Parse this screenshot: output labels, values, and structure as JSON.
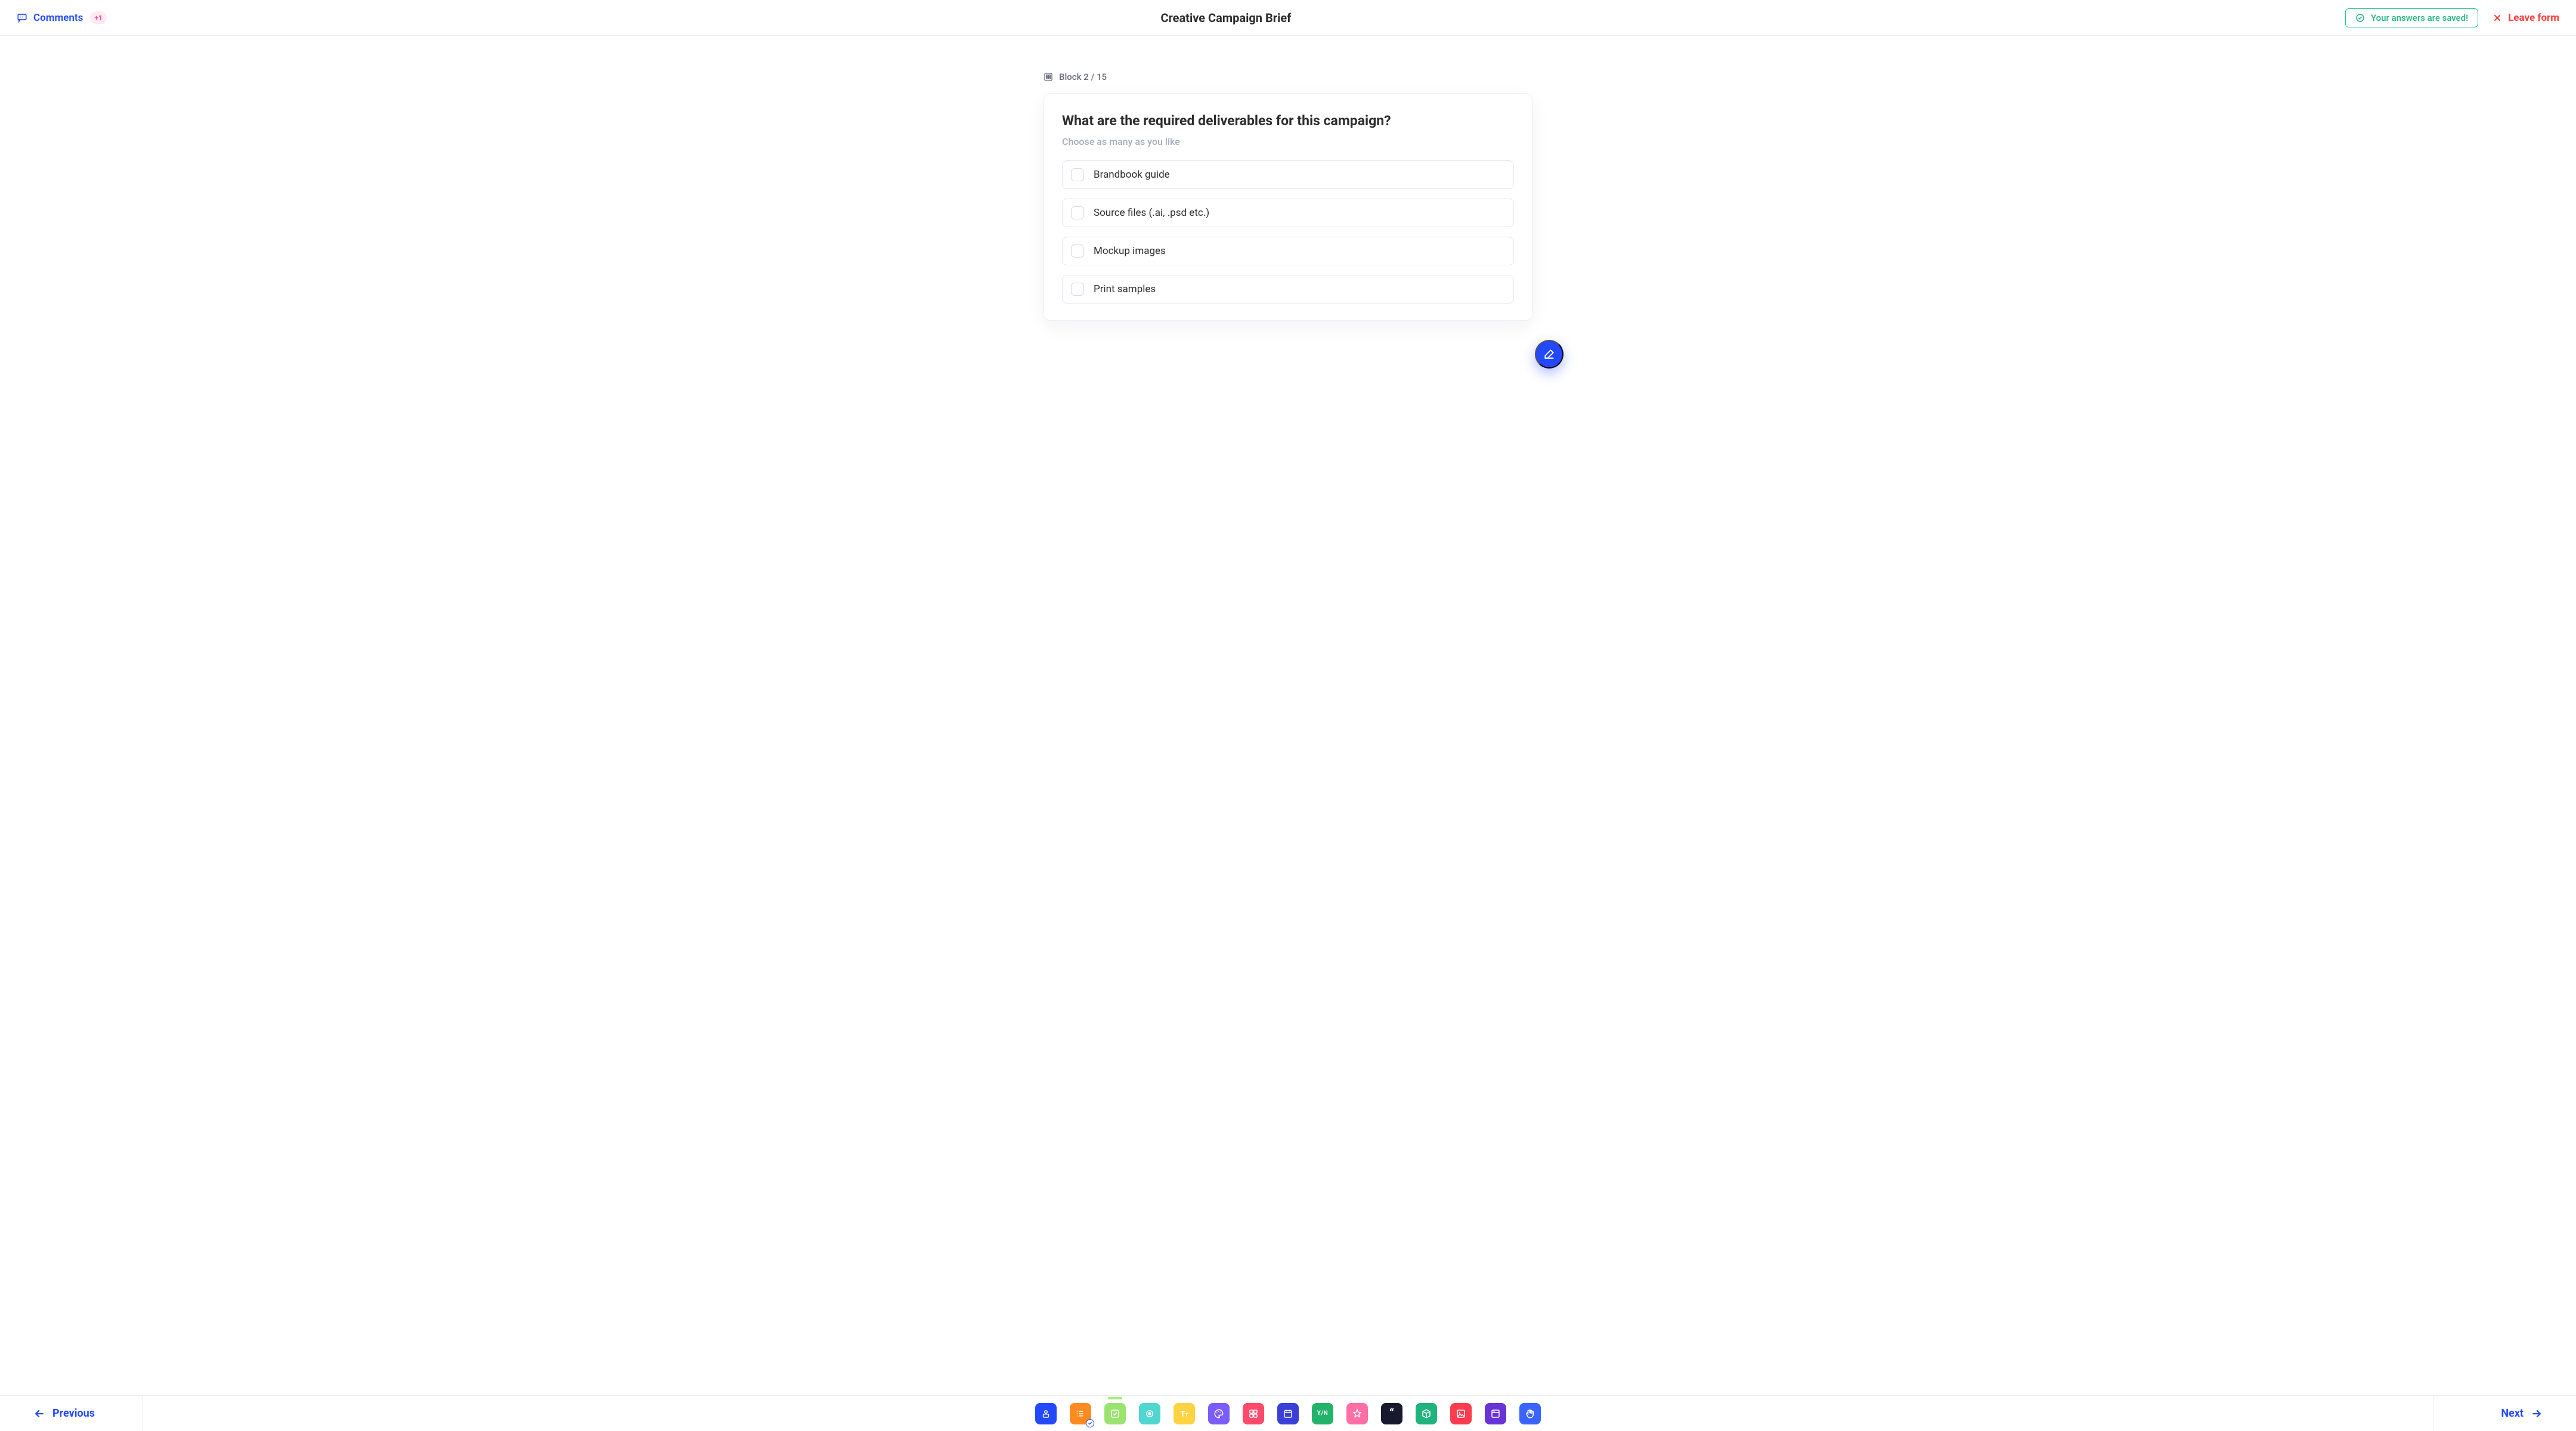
{
  "header": {
    "comments_label": "Comments",
    "comments_count": "+1",
    "title": "Creative Campaign Brief",
    "saved_label": "Your answers are saved!",
    "leave_label": "Leave form"
  },
  "block": {
    "indicator": "Block 2 / 15",
    "question": "What are the required deliverables for this campaign?",
    "hint": "Choose as many as you like",
    "options": [
      {
        "label": "Brandbook guide"
      },
      {
        "label": "Source files (.ai, .psd etc.)"
      },
      {
        "label": "Mockup images"
      },
      {
        "label": "Print samples"
      }
    ]
  },
  "footer": {
    "prev_label": "Previous",
    "next_label": "Next",
    "tiles": [
      {
        "name": "contact-block",
        "color": "#2249ff",
        "icon": "user",
        "done": false,
        "active": false
      },
      {
        "name": "list-block",
        "color": "#ff8a1f",
        "icon": "list",
        "done": true,
        "active": false
      },
      {
        "name": "checkbox-block",
        "color": "#9be36f",
        "icon": "check",
        "done": false,
        "active": true
      },
      {
        "name": "radio-block",
        "color": "#4fd6d0",
        "icon": "target",
        "done": false,
        "active": false
      },
      {
        "name": "text-block",
        "color": "#ffd23f",
        "icon": "tt",
        "done": false,
        "active": false
      },
      {
        "name": "color-block",
        "color": "#7b5cff",
        "icon": "palette",
        "done": false,
        "active": false
      },
      {
        "name": "grid-block",
        "color": "#ff4a6b",
        "icon": "grid",
        "done": false,
        "active": false
      },
      {
        "name": "date-block",
        "color": "#3a3fd8",
        "icon": "calendar",
        "done": false,
        "active": false
      },
      {
        "name": "yesno-block",
        "color": "#22b36b",
        "icon": "yn",
        "done": false,
        "active": false
      },
      {
        "name": "rating-block",
        "color": "#ff6fa6",
        "icon": "star",
        "done": false,
        "active": false
      },
      {
        "name": "quote-block",
        "color": "#171a2e",
        "icon": "quote",
        "done": false,
        "active": false
      },
      {
        "name": "package-block",
        "color": "#1fb37d",
        "icon": "box",
        "done": false,
        "active": false
      },
      {
        "name": "image-block",
        "color": "#ff3b4e",
        "icon": "image",
        "done": false,
        "active": false
      },
      {
        "name": "layout-block",
        "color": "#6a33d6",
        "icon": "window",
        "done": false,
        "active": false
      },
      {
        "name": "signoff-block",
        "color": "#3a63ff",
        "icon": "wave",
        "done": false,
        "active": false
      }
    ]
  }
}
